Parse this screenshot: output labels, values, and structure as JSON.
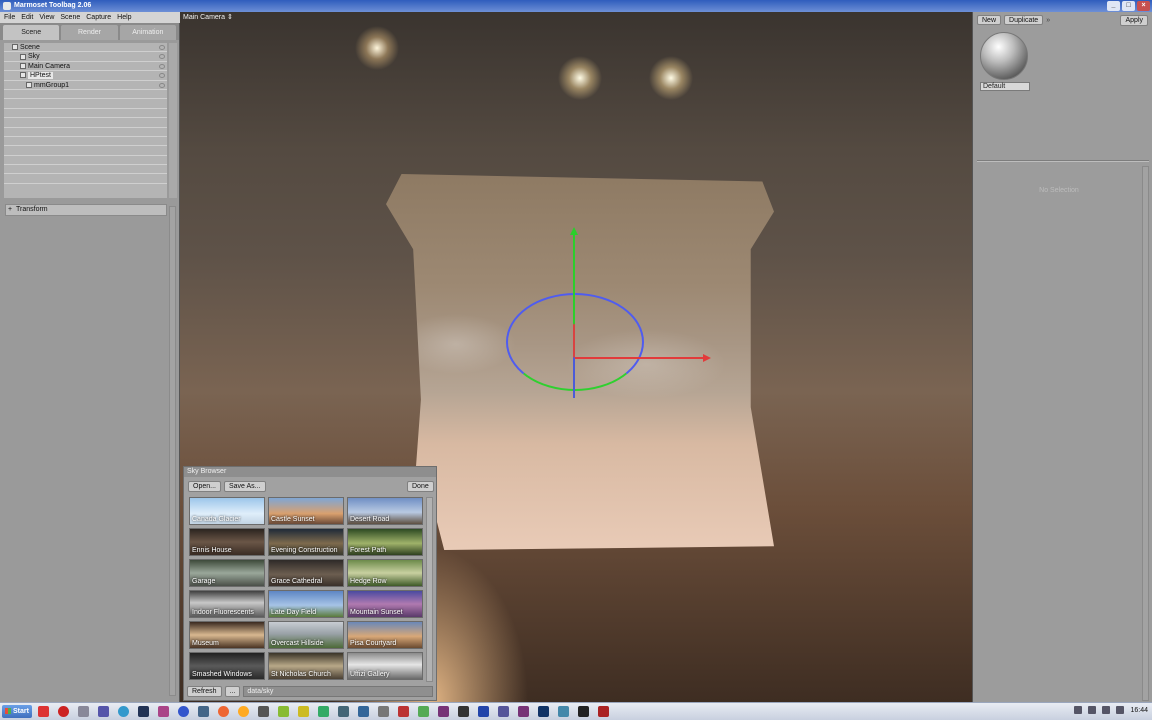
{
  "window": {
    "title": "Marmoset Toolbag 2.06"
  },
  "menu": [
    "File",
    "Edit",
    "View",
    "Scene",
    "Capture",
    "Help"
  ],
  "left_panel": {
    "tabs": [
      "Scene",
      "Render",
      "Animation"
    ],
    "tree": [
      "Scene",
      "Sky",
      "Main Camera",
      "HPtest",
      "mmGroup1"
    ],
    "transform_label": "Transform"
  },
  "viewport": {
    "camera_label": "Main Camera ⇕"
  },
  "right_panel": {
    "new_label": "New",
    "duplicate_label": "Duplicate",
    "arrow_label": "»",
    "apply_label": "Apply",
    "material_name": "Default",
    "no_selection": "No Selection"
  },
  "sky_browser": {
    "title": "Sky Browser",
    "open_label": "Open...",
    "saveas_label": "Save As...",
    "done_label": "Done",
    "refresh_label": "Refresh",
    "browse_label": "...",
    "path": "data/sky",
    "skies": [
      "Canada Glacier",
      "Castle Sunset",
      "Desert Road",
      "Ennis House",
      "Evening Construction",
      "Forest Path",
      "Garage",
      "Grace Cathedral",
      "Hedge Row",
      "Indoor Fluorescents",
      "Late Day Field",
      "Mountain Sunset",
      "Museum",
      "Overcast Hillside",
      "Pisa Courtyard",
      "Smashed Windows",
      "St Nicholas Church",
      "Uffizi Gallery"
    ]
  },
  "taskbar": {
    "start_label": "Start",
    "clock": "16:44"
  }
}
